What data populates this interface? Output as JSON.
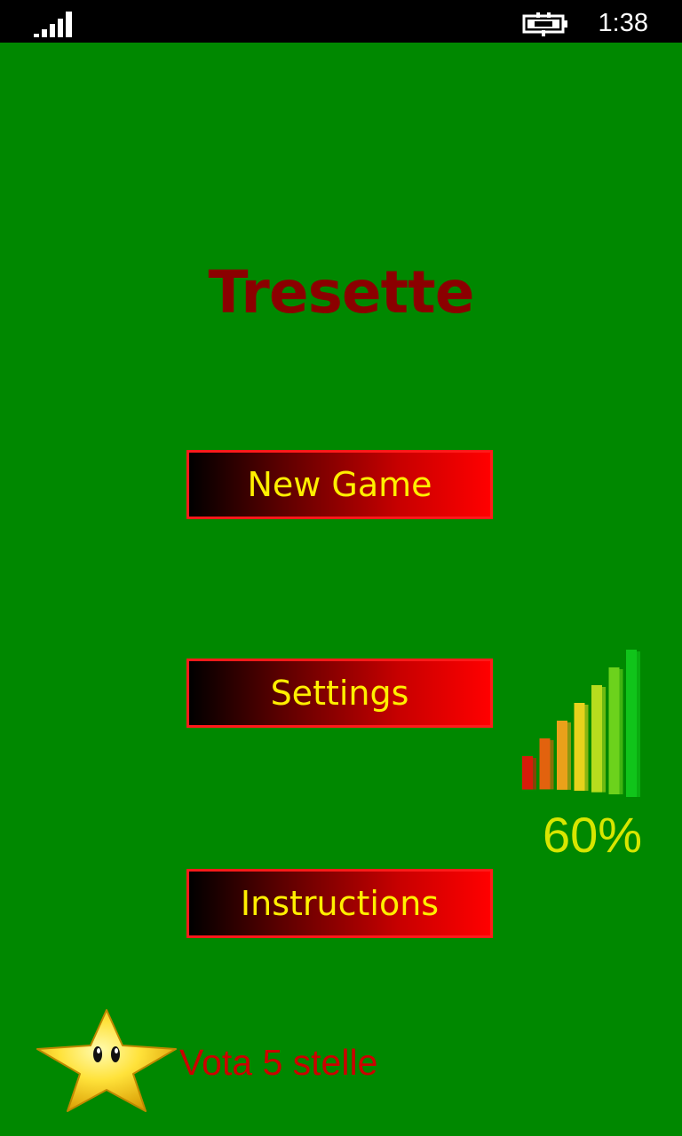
{
  "status_bar": {
    "time": "1:38",
    "icons": [
      "signal-strength-icon",
      "battery-charging-icon"
    ]
  },
  "app": {
    "title": "Tresette"
  },
  "menu": {
    "new_game_label": "New Game",
    "settings_label": "Settings",
    "instructions_label": "Instructions"
  },
  "progress": {
    "value": 60,
    "label": "60%",
    "bar_colors": [
      "#d81b0a",
      "#e2620e",
      "#eaa11a",
      "#e8d21c",
      "#b7dc1e",
      "#6cd21c",
      "#10c41a"
    ]
  },
  "rate": {
    "label": "Vota 5 stelle",
    "icon": "star-icon"
  },
  "colors": {
    "background": "#008800",
    "title": "#8b0000",
    "button_text": "#ffef00",
    "button_border": "#ff1a1a",
    "rate_text": "#cc0000",
    "progress_text": "#d8e600"
  }
}
